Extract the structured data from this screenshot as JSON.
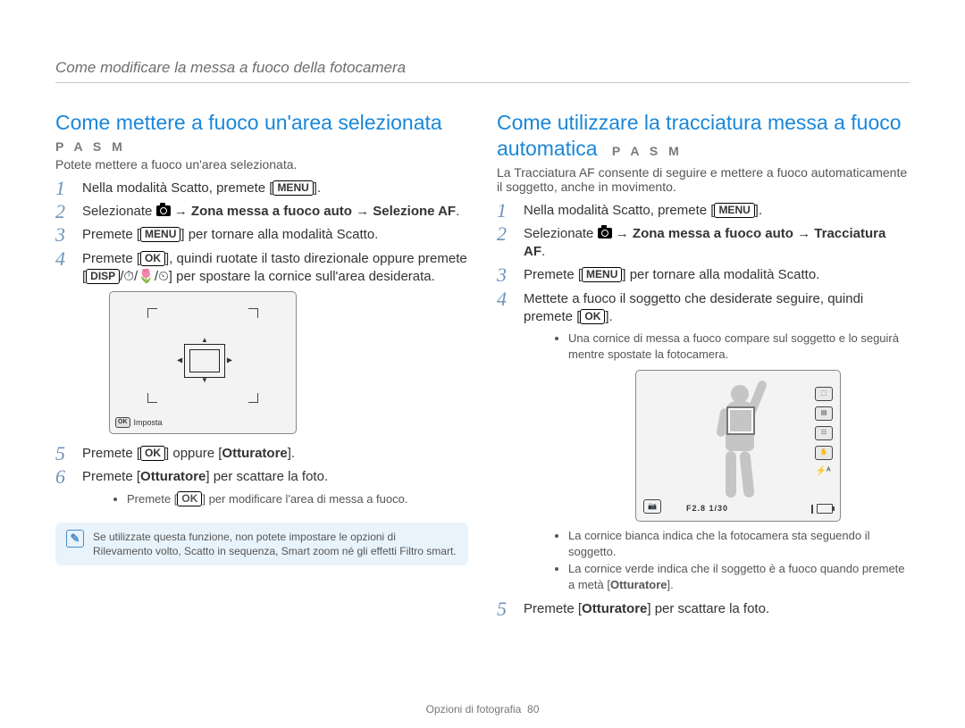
{
  "running_head": "Come modificare la messa a fuoco della fotocamera",
  "footer": {
    "label": "Opzioni di fotografia",
    "page": "80"
  },
  "labels": {
    "btn_menu": "MENU",
    "btn_ok": "OK",
    "btn_disp": "DISP"
  },
  "left": {
    "title": "Come mettere a fuoco un'area selezionata",
    "modes": "P A S M",
    "intro": "Potete mettere a fuoco un'area selezionata.",
    "step1_a": "Nella modalità Scatto, premete [",
    "step1_b": "].",
    "step2_a": "Selezionate ",
    "step2_b": " → ",
    "step2_c": "Zona messa a fuoco auto",
    "step2_d": " → ",
    "step2_e": "Selezione AF",
    "step2_f": ".",
    "step3_a": "Premete [",
    "step3_b": "] per tornare alla modalità Scatto.",
    "step4_a": "Premete [",
    "step4_b": "], quindi ruotate il tasto direzionale oppure premete [",
    "step4_c": "/",
    "step4_icons": "⏱/🌷/⏲",
    "step4_d": "] per spostare la cornice sull'area desiderata.",
    "lcd_label": "Imposta",
    "step5_a": "Premete [",
    "step5_b": "] oppure [",
    "step5_c": "Otturatore",
    "step5_d": "].",
    "step6_a": "Premete [",
    "step6_b": "Otturatore",
    "step6_c": "] per scattare la foto.",
    "sub1_a": "Premete [",
    "sub1_b": "] per modificare l'area di messa a fuoco.",
    "note": "Se utilizzate questa funzione, non potete impostare le opzioni di Rilevamento volto, Scatto in sequenza, Smart zoom né gli effetti Filtro smart."
  },
  "right": {
    "title": "Come utilizzare la tracciatura messa a fuoco automatica",
    "modes": "P A S M",
    "intro": "La Tracciatura AF consente di seguire e mettere a fuoco automaticamente il soggetto, anche in movimento.",
    "step1_a": "Nella modalità Scatto, premete [",
    "step1_b": "].",
    "step2_a": "Selezionate ",
    "step2_b": " → ",
    "step2_c": "Zona messa a fuoco auto",
    "step2_d": " → ",
    "step2_e": "Tracciatura AF",
    "step2_f": ".",
    "step3_a": "Premete [",
    "step3_b": "] per tornare alla modalità Scatto.",
    "step4_a": "Mettete a fuoco il soggetto che desiderate seguire, quindi premete [",
    "step4_b": "].",
    "sub1": "Una cornice di messa a fuoco compare sul soggetto e lo seguirà mentre spostate la fotocamera.",
    "lcd_bottom": "F2.8  1/30",
    "sub2": "La cornice bianca indica che la fotocamera sta seguendo il soggetto.",
    "sub3_a": "La cornice verde indica che il soggetto è a fuoco quando premete a metà [",
    "sub3_b": "Otturatore",
    "sub3_c": "].",
    "step5_a": "Premete [",
    "step5_b": "Otturatore",
    "step5_c": "] per scattare la foto."
  }
}
